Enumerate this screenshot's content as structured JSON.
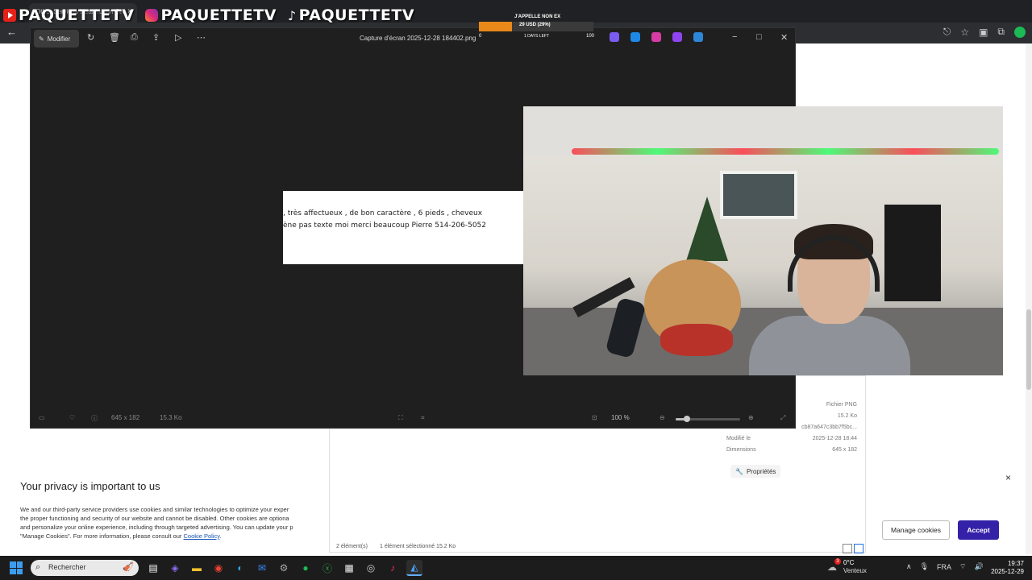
{
  "browser": {
    "tab_title": "Other Services Near You in Gre",
    "tab_close": "×",
    "back_glyph": "←",
    "right_icons": [
      "⎋",
      "☆",
      "▣",
      "⧉"
    ]
  },
  "stream_overlay": {
    "items": [
      {
        "platform": "youtube",
        "label": "PAQUETTETV"
      },
      {
        "platform": "instagram",
        "label": "PAQUETTETV"
      },
      {
        "platform": "tiktok",
        "label": "PAQUETTETV"
      }
    ],
    "goal": {
      "title": "J'APPELLE NON EX",
      "amount": "29 USD (29%)",
      "progress": 0.29,
      "min": "0",
      "max": "100",
      "days_left": "1 DAYS LEFT",
      "color": "#e8891a"
    }
  },
  "viewer": {
    "modify_label": "Modifier",
    "title": "Capture d'écran 2025-12-28 184402.png",
    "image_lines": [
      ", très affectueux , de bon caractère , 6 pieds , cheveux",
      "ène pas texte moi merci beaucoup Pierre 514-206-5052"
    ],
    "status": {
      "dimensions": "645 x 182",
      "filesize": "15.3 Ko",
      "zoom": "100 %",
      "zoom_level": 0.18
    }
  },
  "explorer": {
    "properties": [
      {
        "key": "",
        "value": "Fichier PNG"
      },
      {
        "key": "",
        "value": "15.2 Ko"
      },
      {
        "key": "",
        "value": "cb87a647c3bb7f5bc..."
      },
      {
        "key": "Modifié le",
        "value": "2025-12-28 18:44"
      },
      {
        "key": "Dimensions",
        "value": "645 x 182"
      }
    ],
    "properties_button": "Propriétés",
    "status_count": "2 élément(s)",
    "status_selected": "1 élément sélectionné  15.2 Ko"
  },
  "privacy": {
    "title": "Your privacy is important to us",
    "lines": [
      "We and our third-party service providers use cookies and similar technologies to optimize your exper",
      "the proper functioning and security of our website and cannot be disabled. Other cookies are optiona",
      "and personalize your online experience, including through targeted advertising. You can update your p",
      "\"Manage Cookies\". For more information, please consult our "
    ],
    "link": "Cookie Policy",
    "link_suffix": ".",
    "close_glyph": "×",
    "manage_label": "Manage cookies",
    "accept_label": "Accept",
    "accept_color": "#3322a8"
  },
  "taskbar": {
    "search_placeholder": "Rechercher",
    "weather_temp": "0°C",
    "weather_cond": "Venteux",
    "weather_badge": "3",
    "lang": "FRA",
    "time": "19:37",
    "date": "2025-12-29"
  }
}
